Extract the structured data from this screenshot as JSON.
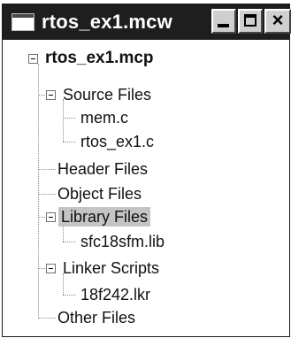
{
  "window": {
    "title": "rtos_ex1.mcw",
    "buttons": {
      "minimize": "minimize",
      "maximize": "maximize",
      "close": "×"
    }
  },
  "tree": {
    "root": "rtos_ex1.mcp",
    "nodes": [
      {
        "label": "Source Files",
        "expanded": true,
        "children": [
          "mem.c",
          "rtos_ex1.c"
        ]
      },
      {
        "label": "Header Files",
        "expanded": false,
        "children": []
      },
      {
        "label": "Object Files",
        "expanded": false,
        "children": []
      },
      {
        "label": "Library Files",
        "expanded": true,
        "selected": true,
        "children": [
          "sfc18sfm.lib"
        ]
      },
      {
        "label": "Linker Scripts",
        "expanded": true,
        "children": [
          "18f242.lkr"
        ]
      },
      {
        "label": "Other Files",
        "expanded": false,
        "children": []
      }
    ]
  },
  "colors": {
    "titlebar": "#1e1e1e",
    "selection": "#c4c4c4"
  }
}
